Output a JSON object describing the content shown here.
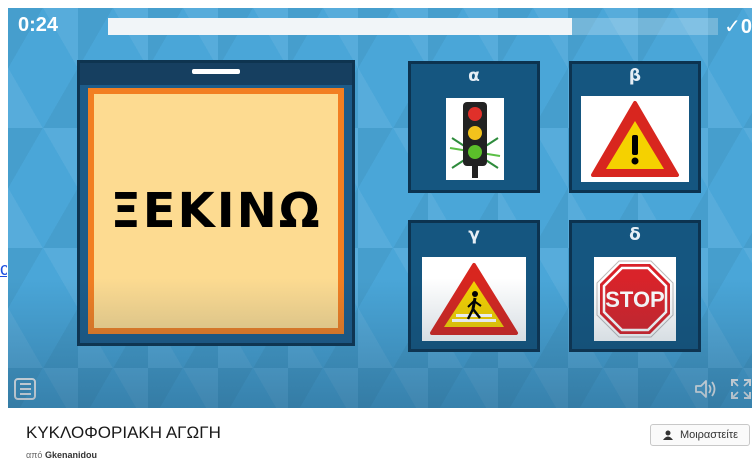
{
  "game": {
    "timer": "0:24",
    "score": "✓0",
    "progress_fraction": 0.76,
    "card_word": "ΞΕΚΙΝΩ",
    "options": [
      {
        "letter": "α",
        "icon": "traffic-light-icon"
      },
      {
        "letter": "β",
        "icon": "warning-sign-icon"
      },
      {
        "letter": "γ",
        "icon": "pedestrian-crossing-sign-icon"
      },
      {
        "letter": "δ",
        "icon": "stop-sign-icon",
        "sign_text": "STOP"
      }
    ]
  },
  "page": {
    "title": "ΚΥΚΛΟΦΟΡΙΑΚΗ ΑΓΩΓΗ",
    "by_prefix": "από",
    "author": "Gkenanidou",
    "share_label": "Μοιραστείτε"
  },
  "colors": {
    "stage_bg": "#4aa6d8",
    "card_border": "#f27f22",
    "card_face": "#fddb91",
    "option_bg": "#155680"
  }
}
